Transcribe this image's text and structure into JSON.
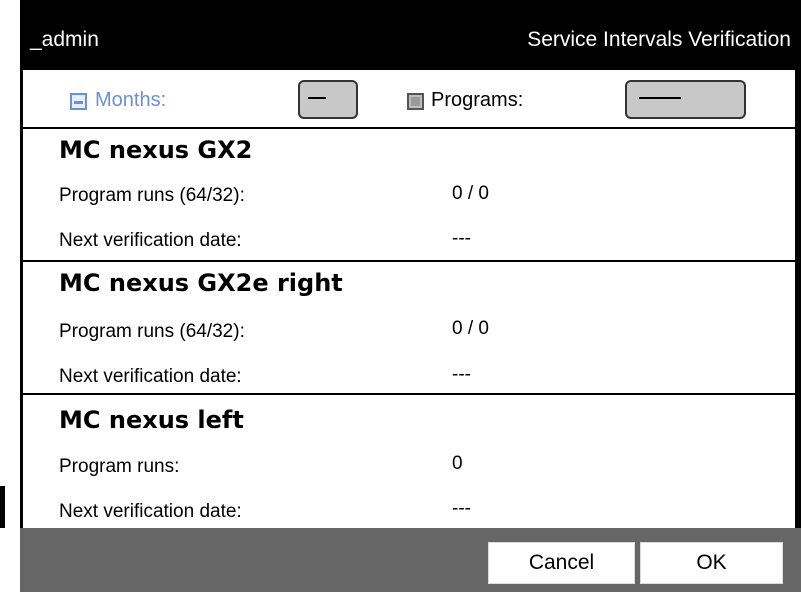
{
  "window": {
    "user": "_admin",
    "title": "Service Intervals Verification"
  },
  "filters": {
    "months_label": "Months:",
    "months_value": "—",
    "programs_label": "Programs:",
    "programs_value": "—"
  },
  "sections": [
    {
      "title": "MC nexus GX2",
      "runs_label": "Program runs (64/32):",
      "runs_value": "0 / 0",
      "date_label": "Next verification date:",
      "date_value": "---"
    },
    {
      "title": "MC nexus GX2e right",
      "runs_label": "Program runs (64/32):",
      "runs_value": "0 / 0",
      "date_label": "Next verification date:",
      "date_value": "---"
    },
    {
      "title": "MC nexus left",
      "runs_label": "Program runs:",
      "runs_value": "0",
      "date_label": "Next verification date:",
      "date_value": "---"
    }
  ],
  "buttons": {
    "cancel": "Cancel",
    "ok": "OK"
  }
}
